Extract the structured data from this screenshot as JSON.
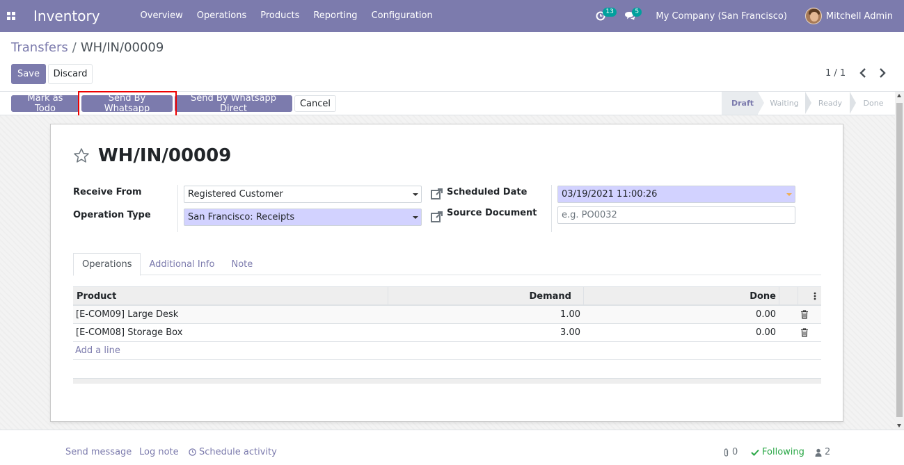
{
  "app": {
    "name": "Inventory",
    "menu": [
      "Overview",
      "Operations",
      "Products",
      "Reporting",
      "Configuration"
    ],
    "activity_count": "13",
    "message_count": "5",
    "company": "My Company (San Francisco)",
    "user": "Mitchell Admin"
  },
  "breadcrumb": {
    "parent": "Transfers",
    "separator": "/",
    "current": "WH/IN/00009"
  },
  "control": {
    "save_label": "Save",
    "discard_label": "Discard",
    "pager": "1 / 1"
  },
  "statusbar": {
    "buttons": [
      "Mark as Todo",
      "Send By Whatsapp",
      "Send By Whatsapp Direct",
      "Cancel"
    ],
    "stages": [
      "Draft",
      "Waiting",
      "Ready",
      "Done"
    ],
    "active_stage": "Draft"
  },
  "form": {
    "title": "WH/IN/00009",
    "receive_from_label": "Receive From",
    "receive_from_value": "Registered Customer",
    "operation_type_label": "Operation Type",
    "operation_type_value": "San Francisco: Receipts",
    "scheduled_date_label": "Scheduled Date",
    "scheduled_date_value": "03/19/2021 11:00:26",
    "source_document_label": "Source Document",
    "source_document_placeholder": "e.g. PO0032"
  },
  "tabs": [
    "Operations",
    "Additional Info",
    "Note"
  ],
  "table": {
    "headers": {
      "product": "Product",
      "demand": "Demand",
      "done": "Done"
    },
    "rows": [
      {
        "product": "[E-COM09] Large Desk",
        "demand": "1.00",
        "done": "0.00"
      },
      {
        "product": "[E-COM08] Storage Box",
        "demand": "3.00",
        "done": "0.00"
      }
    ],
    "add_line": "Add a line"
  },
  "chatter": {
    "send_message": "Send message",
    "log_note": "Log note",
    "schedule_activity": "Schedule activity",
    "attachments": "0",
    "following": "Following",
    "followers": "2"
  },
  "colors": {
    "brand": "#7c7bad",
    "badge": "#00a09d",
    "required_field": "#d2d2ff",
    "following": "#28a745",
    "highlight": "#e00000"
  }
}
